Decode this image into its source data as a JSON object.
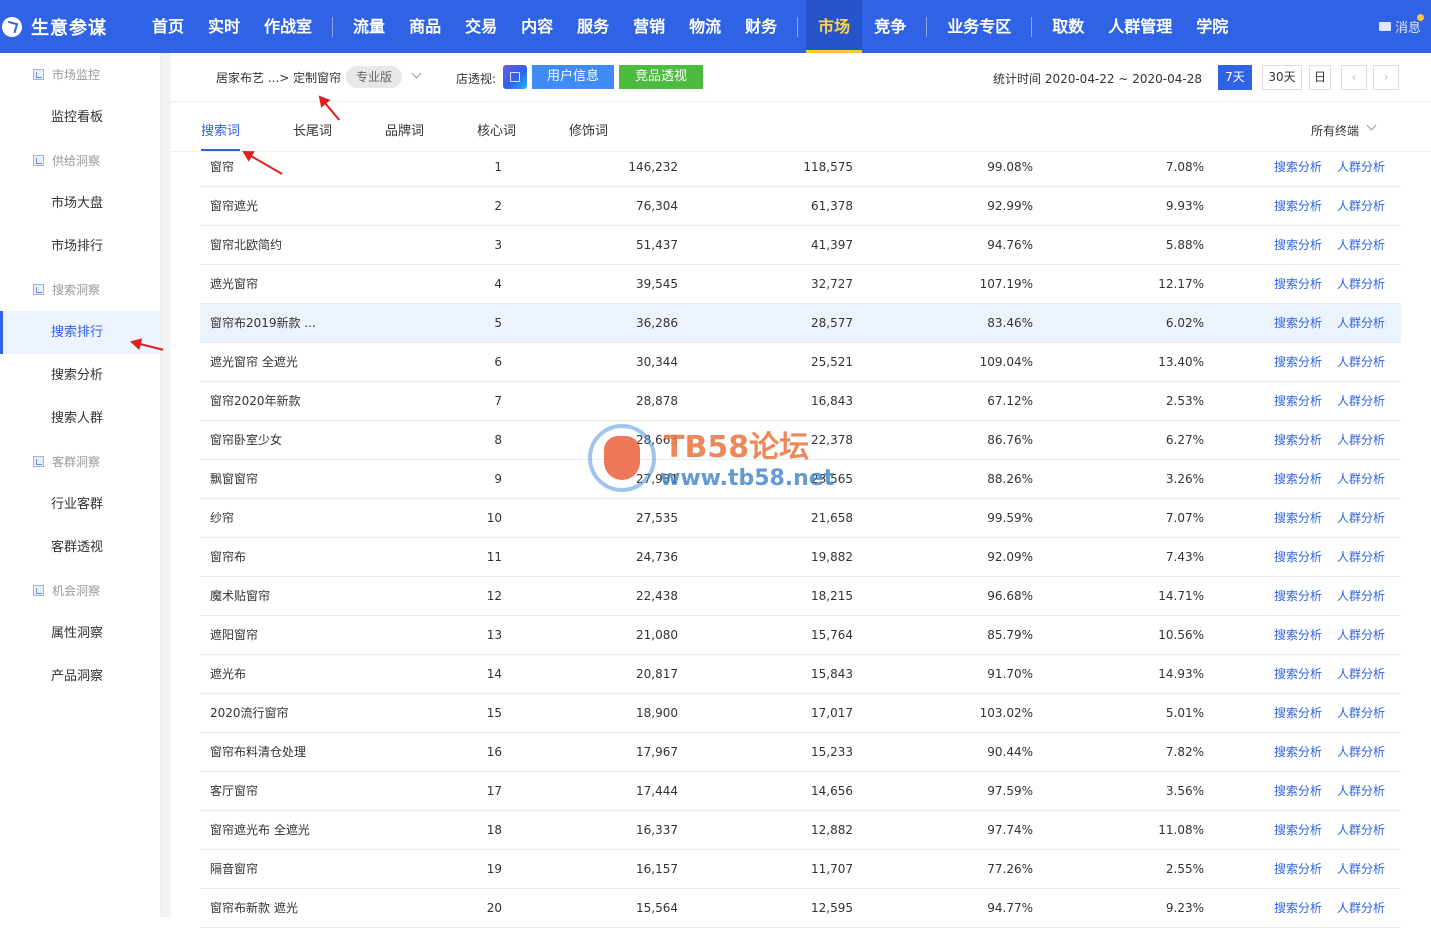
{
  "app": {
    "brand": "生意参谋",
    "nav": [
      {
        "label": "首页",
        "dot": false,
        "sep_after": false
      },
      {
        "label": "实时",
        "dot": false,
        "sep_after": false
      },
      {
        "label": "作战室",
        "dot": true,
        "sep_after": true
      },
      {
        "label": "流量",
        "dot": false,
        "sep_after": false
      },
      {
        "label": "商品",
        "dot": false,
        "sep_after": false
      },
      {
        "label": "交易",
        "dot": false,
        "sep_after": false
      },
      {
        "label": "内容",
        "dot": false,
        "sep_after": false
      },
      {
        "label": "服务",
        "dot": false,
        "sep_after": false
      },
      {
        "label": "营销",
        "dot": false,
        "sep_after": false
      },
      {
        "label": "物流",
        "dot": false,
        "sep_after": false
      },
      {
        "label": "财务",
        "dot": false,
        "sep_after": true
      },
      {
        "label": "市场",
        "dot": false,
        "sep_after": false,
        "active": true
      },
      {
        "label": "竞争",
        "dot": false,
        "sep_after": true
      },
      {
        "label": "业务专区",
        "dot": false,
        "sep_after": true
      },
      {
        "label": "取数",
        "dot": false,
        "sep_after": false
      },
      {
        "label": "人群管理",
        "dot": true,
        "sep_after": false
      },
      {
        "label": "学院",
        "dot": false,
        "sep_after": false
      }
    ],
    "message_label": "消息"
  },
  "sidebar": [
    {
      "type": "group",
      "label": "市场监控"
    },
    {
      "type": "item",
      "label": "监控看板"
    },
    {
      "type": "group",
      "label": "供给洞察"
    },
    {
      "type": "item",
      "label": "市场大盘"
    },
    {
      "type": "item",
      "label": "市场排行"
    },
    {
      "type": "group",
      "label": "搜索洞察"
    },
    {
      "type": "item",
      "label": "搜索排行",
      "active": true
    },
    {
      "type": "item",
      "label": "搜索分析"
    },
    {
      "type": "item",
      "label": "搜索人群"
    },
    {
      "type": "group",
      "label": "客群洞察"
    },
    {
      "type": "item",
      "label": "行业客群"
    },
    {
      "type": "item",
      "label": "客群透视"
    },
    {
      "type": "group",
      "label": "机会洞察"
    },
    {
      "type": "item",
      "label": "属性洞察"
    },
    {
      "type": "item",
      "label": "产品洞察"
    }
  ],
  "filters": {
    "breadcrumb": "居家布艺 ...> 定制窗帘",
    "edition": "专业版",
    "store_label": "店透视:",
    "user_info_button": "用户信息",
    "competitor_button": "竞品透视",
    "stat_time": "统计时间 2020-04-22 ~ 2020-04-28",
    "range_7d": "7天",
    "range_30d": "30天",
    "range_day": "日",
    "prev": "‹",
    "next": "›"
  },
  "tabs": [
    {
      "label": "搜索词",
      "active": true
    },
    {
      "label": "长尾词"
    },
    {
      "label": "品牌词"
    },
    {
      "label": "核心词"
    },
    {
      "label": "修饰词"
    }
  ],
  "device_filter": "所有终端",
  "table": {
    "action_search": "搜索分析",
    "action_crowd": "人群分析",
    "rows": [
      {
        "keyword": "窗帘",
        "rank": "1",
        "v1": "146,232",
        "v2": "118,575",
        "v3": "99.08%",
        "v4": "7.08%"
      },
      {
        "keyword": "窗帘遮光",
        "rank": "2",
        "v1": "76,304",
        "v2": "61,378",
        "v3": "92.99%",
        "v4": "9.93%"
      },
      {
        "keyword": "窗帘北欧简约",
        "rank": "3",
        "v1": "51,437",
        "v2": "41,397",
        "v3": "94.76%",
        "v4": "5.88%"
      },
      {
        "keyword": "遮光窗帘",
        "rank": "4",
        "v1": "39,545",
        "v2": "32,727",
        "v3": "107.19%",
        "v4": "12.17%"
      },
      {
        "keyword": "窗帘布2019新款 ...",
        "rank": "5",
        "v1": "36,286",
        "v2": "28,577",
        "v3": "83.46%",
        "v4": "6.02%",
        "highlight": true
      },
      {
        "keyword": "遮光窗帘 全遮光",
        "rank": "6",
        "v1": "30,344",
        "v2": "25,521",
        "v3": "109.04%",
        "v4": "13.40%"
      },
      {
        "keyword": "窗帘2020年新款",
        "rank": "7",
        "v1": "28,878",
        "v2": "16,843",
        "v3": "67.12%",
        "v4": "2.53%"
      },
      {
        "keyword": "窗帘卧室少女",
        "rank": "8",
        "v1": "28,663",
        "v2": "22,378",
        "v3": "86.76%",
        "v4": "6.27%"
      },
      {
        "keyword": "飘窗窗帘",
        "rank": "9",
        "v1": "27,931",
        "v2": "23,565",
        "v3": "88.26%",
        "v4": "3.26%"
      },
      {
        "keyword": "纱帘",
        "rank": "10",
        "v1": "27,535",
        "v2": "21,658",
        "v3": "99.59%",
        "v4": "7.07%"
      },
      {
        "keyword": "窗帘布",
        "rank": "11",
        "v1": "24,736",
        "v2": "19,882",
        "v3": "92.09%",
        "v4": "7.43%"
      },
      {
        "keyword": "魔术贴窗帘",
        "rank": "12",
        "v1": "22,438",
        "v2": "18,215",
        "v3": "96.68%",
        "v4": "14.71%"
      },
      {
        "keyword": "遮阳窗帘",
        "rank": "13",
        "v1": "21,080",
        "v2": "15,764",
        "v3": "85.79%",
        "v4": "10.56%"
      },
      {
        "keyword": "遮光布",
        "rank": "14",
        "v1": "20,817",
        "v2": "15,843",
        "v3": "91.70%",
        "v4": "14.93%"
      },
      {
        "keyword": "2020流行窗帘",
        "rank": "15",
        "v1": "18,900",
        "v2": "17,017",
        "v3": "103.02%",
        "v4": "5.01%"
      },
      {
        "keyword": "窗帘布料清仓处理",
        "rank": "16",
        "v1": "17,967",
        "v2": "15,233",
        "v3": "90.44%",
        "v4": "7.82%"
      },
      {
        "keyword": "客厅窗帘",
        "rank": "17",
        "v1": "17,444",
        "v2": "14,656",
        "v3": "97.59%",
        "v4": "3.56%"
      },
      {
        "keyword": "窗帘遮光布 全遮光",
        "rank": "18",
        "v1": "16,337",
        "v2": "12,882",
        "v3": "97.74%",
        "v4": "11.08%"
      },
      {
        "keyword": "隔音窗帘",
        "rank": "19",
        "v1": "16,157",
        "v2": "11,707",
        "v3": "77.26%",
        "v4": "2.55%"
      },
      {
        "keyword": "窗帘布新款 遮光",
        "rank": "20",
        "v1": "15,564",
        "v2": "12,595",
        "v3": "94.77%",
        "v4": "9.23%"
      }
    ]
  },
  "watermark": {
    "title": "TB58论坛",
    "url": "www.tb58.net"
  },
  "colors": {
    "brand_blue": "#2f62e5",
    "accent_yellow": "#ffc53d",
    "link_blue": "#2f62e5",
    "green": "#4cbb3f",
    "annotation_red": "#e02020"
  }
}
